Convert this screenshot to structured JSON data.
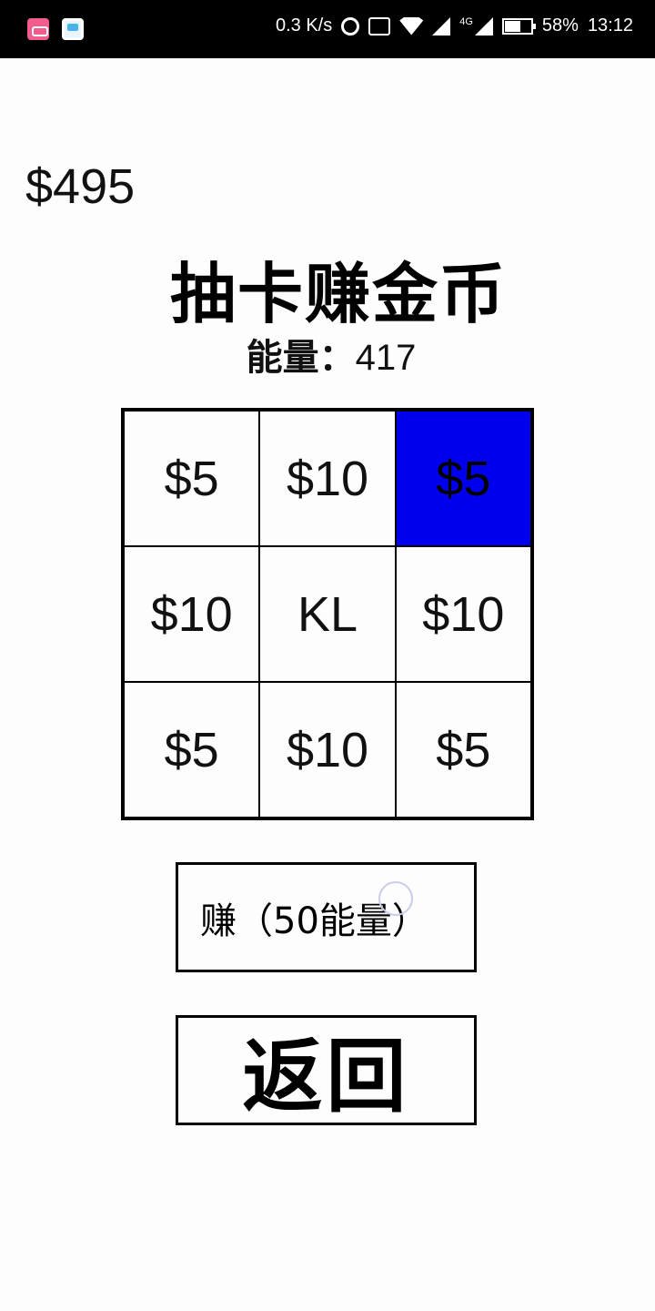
{
  "status_bar": {
    "net_speed": "0.3 K/s",
    "network_type": "4G",
    "battery": "58%",
    "time": "13:12",
    "icons": [
      "bilibili-app-icon",
      "notification-app-icon",
      "alarm-icon",
      "cast-icon",
      "wifi-icon",
      "signal-icon",
      "battery-icon"
    ]
  },
  "wallet": {
    "money": "$495"
  },
  "header": {
    "title": "抽卡赚金币",
    "energy_label": "能量：",
    "energy_value": "417"
  },
  "grid": {
    "cells": [
      "$5",
      "$10",
      "$5",
      "$10",
      "KL",
      "$10",
      "$5",
      "$10",
      "$5"
    ],
    "active_index": 2,
    "active_color": "#0000ee"
  },
  "actions": {
    "earn_label": "赚（50能量）",
    "back_label": "返回"
  }
}
